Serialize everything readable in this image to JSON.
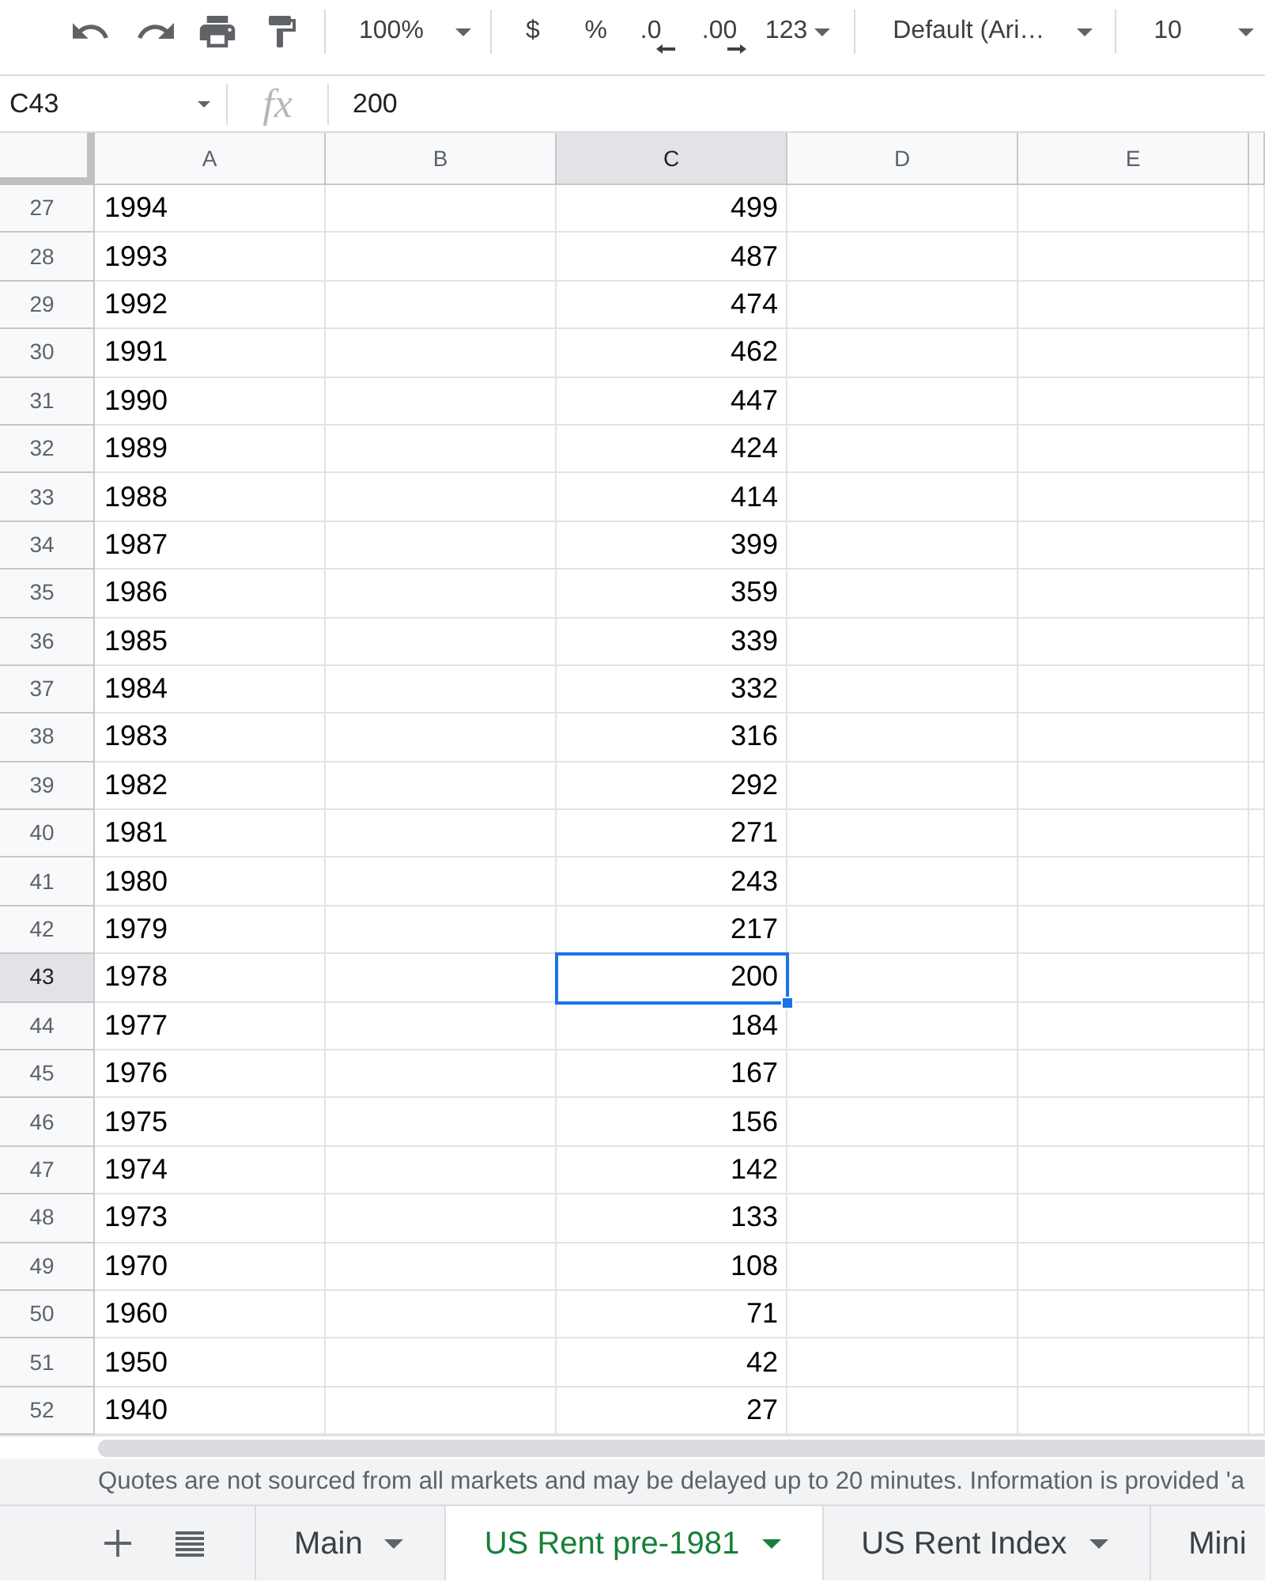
{
  "toolbar": {
    "zoom": "100%",
    "currency": "$",
    "percent": "%",
    "decrease_decimals": ".0",
    "increase_decimals": ".00",
    "more_formats": "123",
    "font": "Default (Ari…",
    "font_size": "10"
  },
  "formula_bar": {
    "cell_ref": "C43",
    "function_label": "fx",
    "value": "200"
  },
  "columns": [
    {
      "label": "A",
      "selected": false
    },
    {
      "label": "B",
      "selected": false
    },
    {
      "label": "C",
      "selected": true
    },
    {
      "label": "D",
      "selected": false
    },
    {
      "label": "E",
      "selected": false
    }
  ],
  "rows": [
    {
      "number": "27",
      "selected": false,
      "column_a": "1994",
      "column_c": "499"
    },
    {
      "number": "28",
      "selected": false,
      "column_a": "1993",
      "column_c": "487"
    },
    {
      "number": "29",
      "selected": false,
      "column_a": "1992",
      "column_c": "474"
    },
    {
      "number": "30",
      "selected": false,
      "column_a": "1991",
      "column_c": "462"
    },
    {
      "number": "31",
      "selected": false,
      "column_a": "1990",
      "column_c": "447"
    },
    {
      "number": "32",
      "selected": false,
      "column_a": "1989",
      "column_c": "424"
    },
    {
      "number": "33",
      "selected": false,
      "column_a": "1988",
      "column_c": "414"
    },
    {
      "number": "34",
      "selected": false,
      "column_a": "1987",
      "column_c": "399"
    },
    {
      "number": "35",
      "selected": false,
      "column_a": "1986",
      "column_c": "359"
    },
    {
      "number": "36",
      "selected": false,
      "column_a": "1985",
      "column_c": "339"
    },
    {
      "number": "37",
      "selected": false,
      "column_a": "1984",
      "column_c": "332"
    },
    {
      "number": "38",
      "selected": false,
      "column_a": "1983",
      "column_c": "316"
    },
    {
      "number": "39",
      "selected": false,
      "column_a": "1982",
      "column_c": "292"
    },
    {
      "number": "40",
      "selected": false,
      "column_a": "1981",
      "column_c": "271"
    },
    {
      "number": "41",
      "selected": false,
      "column_a": "1980",
      "column_c": "243"
    },
    {
      "number": "42",
      "selected": false,
      "column_a": "1979",
      "column_c": "217"
    },
    {
      "number": "43",
      "selected": true,
      "column_a": "1978",
      "column_c": "200"
    },
    {
      "number": "44",
      "selected": false,
      "column_a": "1977",
      "column_c": "184"
    },
    {
      "number": "45",
      "selected": false,
      "column_a": "1976",
      "column_c": "167"
    },
    {
      "number": "46",
      "selected": false,
      "column_a": "1975",
      "column_c": "156"
    },
    {
      "number": "47",
      "selected": false,
      "column_a": "1974",
      "column_c": "142"
    },
    {
      "number": "48",
      "selected": false,
      "column_a": "1973",
      "column_c": "133"
    },
    {
      "number": "49",
      "selected": false,
      "column_a": "1970",
      "column_c": "108"
    },
    {
      "number": "50",
      "selected": false,
      "column_a": "1960",
      "column_c": "71"
    },
    {
      "number": "51",
      "selected": false,
      "column_a": "1950",
      "column_c": "42"
    },
    {
      "number": "52",
      "selected": false,
      "column_a": "1940",
      "column_c": "27"
    }
  ],
  "notice": "Quotes are not sourced from all markets and may be delayed up to 20 minutes. Information is provided 'a",
  "sheet_tabs": [
    {
      "label": "Main",
      "selected": false
    },
    {
      "label": "US Rent pre-1981",
      "selected": true
    },
    {
      "label": "US Rent Index",
      "selected": false
    },
    {
      "label": "Mini",
      "selected": false
    }
  ]
}
